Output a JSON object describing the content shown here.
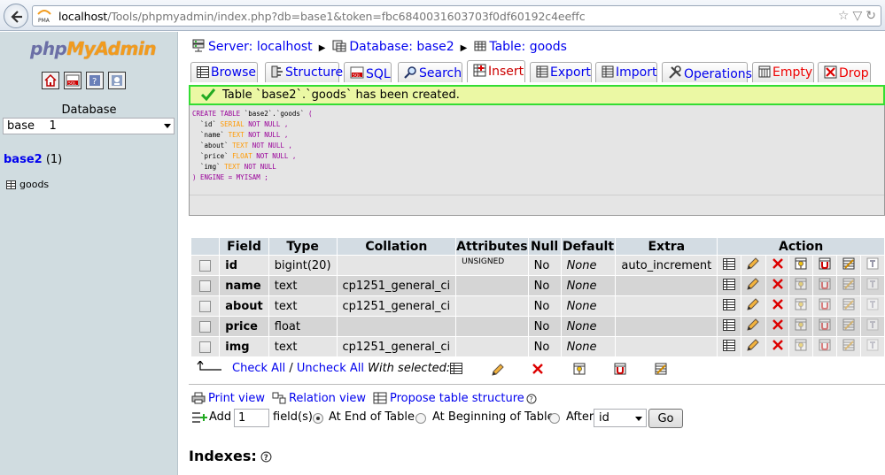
{
  "browser": {
    "url_host": "localhost",
    "url_rest": "/Tools/phpmyadmin/index.php?db=base1&token=fbc6840031603703f0df60192c4eeffc",
    "favicon_label": "PMA"
  },
  "sidebar": {
    "logo_php": "php",
    "logo_myadmin": "MyAdmin",
    "database_label": "Database",
    "database_select": "base    1",
    "db_name": "base2",
    "db_count": " (1)",
    "tables": [
      "goods"
    ]
  },
  "breadcrumb": {
    "server": "Server: localhost",
    "database": "Database: base2",
    "table": "Table: goods"
  },
  "tabs": [
    {
      "label": "Browse",
      "icon": "browse-icon"
    },
    {
      "label": "Structure",
      "icon": "structure-icon"
    },
    {
      "label": "SQL",
      "icon": "sql-icon"
    },
    {
      "label": "Search",
      "icon": "search-icon"
    },
    {
      "label": "Insert",
      "icon": "insert-icon"
    },
    {
      "label": "Export",
      "icon": "export-icon"
    },
    {
      "label": "Import",
      "icon": "import-icon"
    },
    {
      "label": "Operations",
      "icon": "operations-icon"
    },
    {
      "label": "Empty",
      "icon": "empty-icon"
    },
    {
      "label": "Drop",
      "icon": "drop-icon"
    }
  ],
  "notice": "Table `base2`.`goods` has been created.",
  "sql": {
    "l1a": "CREATE TABLE ",
    "l1b": "`base2`.`goods`",
    "l1c": " (",
    "c1": "`id` ",
    "t1": "SERIAL",
    "n1": " NOT NULL ,",
    "c2": "`name` ",
    "t2": "TEXT",
    "n2": " NOT NULL ,",
    "c3": "`about` ",
    "t3": "TEXT",
    "n3": " NOT NULL ,",
    "c4": "`price` ",
    "t4": "FLOAT",
    "n4": " NOT NULL ,",
    "c5": "`img` ",
    "t5": "TEXT",
    "n5": " NOT NULL",
    "end": ") ENGINE = MYISAM ;"
  },
  "structure": {
    "headers": [
      "Field",
      "Type",
      "Collation",
      "Attributes",
      "Null",
      "Default",
      "Extra",
      "Action"
    ],
    "rows": [
      {
        "field": "id",
        "type": "bigint(20)",
        "collation": "",
        "attributes": "UNSIGNED",
        "null": "No",
        "default": "None",
        "extra": "auto_increment"
      },
      {
        "field": "name",
        "type": "text",
        "collation": "cp1251_general_ci",
        "attributes": "",
        "null": "No",
        "default": "None",
        "extra": ""
      },
      {
        "field": "about",
        "type": "text",
        "collation": "cp1251_general_ci",
        "attributes": "",
        "null": "No",
        "default": "None",
        "extra": ""
      },
      {
        "field": "price",
        "type": "float",
        "collation": "",
        "attributes": "",
        "null": "No",
        "default": "None",
        "extra": ""
      },
      {
        "field": "img",
        "type": "text",
        "collation": "cp1251_general_ci",
        "attributes": "",
        "null": "No",
        "default": "None",
        "extra": ""
      }
    ],
    "action_icons": [
      "browse-icon",
      "edit-icon",
      "delete-icon",
      "primary-key-icon",
      "unique-icon",
      "index-icon",
      "fulltext-icon"
    ]
  },
  "with_selected": {
    "check_all": "Check All",
    "slash": " / ",
    "uncheck_all": "Uncheck All",
    "label": " With selected:"
  },
  "links": {
    "print_view": "Print view",
    "relation_view": "Relation view",
    "propose": "Propose table structure"
  },
  "add_fields": {
    "add_label": "Add",
    "count": "1",
    "fields_label": "field(s)",
    "end_label": "At End of Table",
    "beginning_label": "At Beginning of Table",
    "after_label": "After",
    "after_value": "id",
    "go_label": "Go"
  },
  "indexes_title": "Indexes:",
  "colors": {
    "link": "#0000ee",
    "sidebar_bg": "#d0dce0",
    "header_bg": "#d3dce3",
    "notice_bg": "#ebf8a4",
    "notice_border": "#33dd33"
  }
}
